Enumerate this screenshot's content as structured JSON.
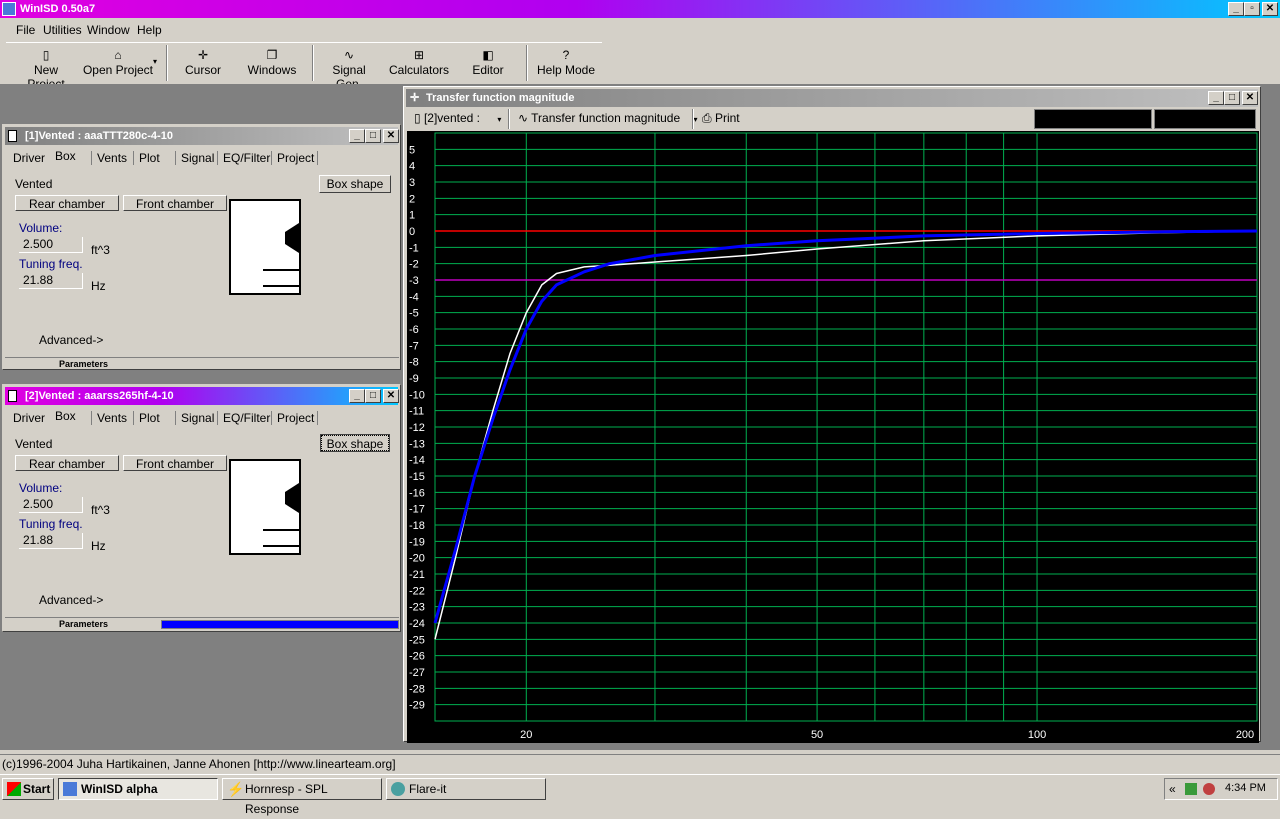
{
  "app": {
    "title": "WinISD 0.50a7"
  },
  "menu": [
    "File",
    "Utilities",
    "Window",
    "Help"
  ],
  "toolbar": {
    "new_project": "New Project",
    "open_project": "Open Project",
    "cursor": "Cursor",
    "windows": "Windows",
    "signal_gen": "Signal Gen.",
    "calculators": "Calculators",
    "editor": "Editor",
    "help_mode": "Help Mode"
  },
  "project1": {
    "title": "[1]Vented : aaaTTT280c-4-10",
    "tabs": [
      "Driver",
      "Box",
      "Vents",
      "Plot",
      "Signal",
      "EQ/Filter",
      "Project"
    ],
    "box_type": "Vented",
    "box_shape_btn": "Box shape",
    "rear_chamber": "Rear chamber",
    "front_chamber": "Front chamber",
    "volume_label": "Volume:",
    "volume_value": "2.500",
    "volume_unit": "ft^3",
    "tuning_label": "Tuning freq.",
    "tuning_value": "21.88",
    "tuning_unit": "Hz",
    "advanced": "Advanced->",
    "status_label": "Parameters",
    "progress": 0
  },
  "project2": {
    "title": "[2]Vented : aaarss265hf-4-10",
    "tabs": [
      "Driver",
      "Box",
      "Vents",
      "Plot",
      "Signal",
      "EQ/Filter",
      "Project"
    ],
    "box_type": "Vented",
    "box_shape_btn": "Box shape",
    "rear_chamber": "Rear chamber",
    "front_chamber": "Front chamber",
    "volume_label": "Volume:",
    "volume_value": "2.500",
    "volume_unit": "ft^3",
    "tuning_label": "Tuning freq.",
    "tuning_value": "21.88",
    "tuning_unit": "Hz",
    "advanced": "Advanced->",
    "status_label": "Parameters",
    "progress": 1.0
  },
  "graph": {
    "title": "Transfer function magnitude",
    "project_select": "[2]vented :",
    "graph_select": "Transfer function magnitude",
    "print": "Print"
  },
  "chart_data": {
    "type": "line",
    "xscale": "log",
    "xlim": [
      15,
      200
    ],
    "ylim": [
      -30,
      6
    ],
    "xticks": [
      20,
      50,
      100,
      200
    ],
    "yticks": [
      5,
      4,
      3,
      2,
      1,
      0,
      -1,
      -2,
      -3,
      -4,
      -5,
      -6,
      -7,
      -8,
      -9,
      -10,
      -11,
      -12,
      -13,
      -14,
      -15,
      -16,
      -17,
      -18,
      -19,
      -20,
      -21,
      -22,
      -23,
      -24,
      -25,
      -26,
      -27,
      -28,
      -29
    ],
    "reference_lines": [
      {
        "y": 0,
        "color": "#ff0000"
      },
      {
        "y": -3,
        "color": "#c000c0"
      }
    ],
    "grid": true,
    "series": [
      {
        "color": "#ffffff",
        "x": [
          15,
          16,
          17,
          18,
          19,
          20,
          21,
          22,
          24,
          26,
          30,
          40,
          50,
          70,
          100,
          150,
          200
        ],
        "y": [
          -25,
          -20,
          -15,
          -11,
          -7.5,
          -5,
          -3.3,
          -2.6,
          -2.2,
          -2.1,
          -1.9,
          -1.5,
          -1.1,
          -0.6,
          -0.3,
          -0.1,
          0
        ]
      },
      {
        "color": "#0000ff",
        "x": [
          15,
          16,
          17,
          18,
          19,
          20,
          21,
          22,
          24,
          26,
          30,
          40,
          50,
          70,
          100,
          150,
          200
        ],
        "y": [
          -24,
          -19.5,
          -15,
          -11.5,
          -8.5,
          -6,
          -4.3,
          -3.3,
          -2.5,
          -2,
          -1.5,
          -0.9,
          -0.6,
          -0.3,
          -0.15,
          -0.05,
          0
        ]
      }
    ]
  },
  "statusbar": "(c)1996-2004 Juha Hartikainen, Janne Ahonen [http://www.linearteam.org]",
  "taskbar": {
    "start": "Start",
    "tasks": [
      "WinISD alpha",
      "Hornresp - SPL Response",
      "Flare-it"
    ],
    "tray_arrows": "«",
    "clock": "4:34 PM"
  },
  "colors": {
    "plot_bg": "#000000",
    "grid": "#00b050",
    "axis_text": "#ffffff"
  }
}
